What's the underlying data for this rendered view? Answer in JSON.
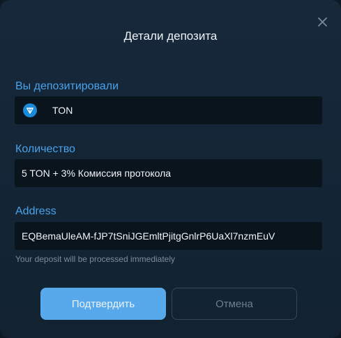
{
  "dialog": {
    "title": "Детали депозита",
    "close_icon": "close-icon"
  },
  "fields": {
    "deposited": {
      "label": "Вы депозитировали",
      "value": "TON",
      "icon": "ton-coin-icon"
    },
    "amount": {
      "label": "Количество",
      "value": "5 TON + 3% Комиссия протокола"
    },
    "address": {
      "label": "Address",
      "value": "EQBemaUleAM-fJP7tSniJGEmltPjitgGnlrP6UaXl7nzmEuV",
      "hint": "Your deposit will be processed immediately"
    }
  },
  "buttons": {
    "confirm_label": "Подтвердить",
    "cancel_label": "Отмена"
  },
  "colors": {
    "accent": "#4aa3ea",
    "primary_button": "#57a9ec",
    "background": "#132535",
    "field_background": "#0a141d"
  }
}
